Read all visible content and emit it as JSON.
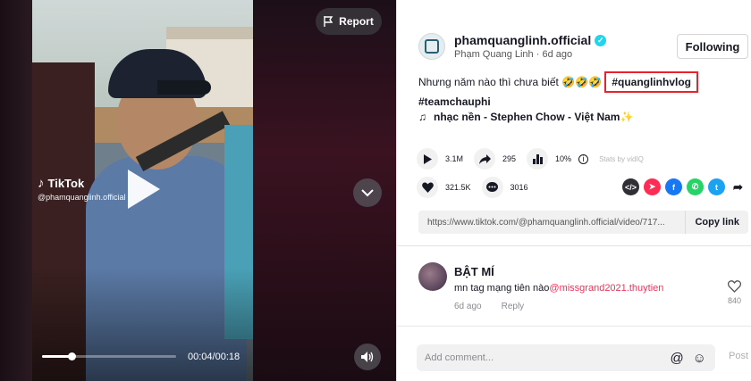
{
  "video": {
    "watermark_brand": "TikTok",
    "watermark_handle": "@phamquanglinh.official",
    "report_label": "Report",
    "time_display": "00:04/00:18",
    "progress_fraction": 0.22
  },
  "author": {
    "username": "phamquanglinh.official",
    "display_name": "Phạm Quang Linh",
    "posted": "6d ago",
    "follow_label": "Following"
  },
  "caption": {
    "text": "Nhưng năm nào thì chưa biết 🤣🤣🤣",
    "hashtag_highlighted": "#quanglinhvlog",
    "hashtag_2": "#teamchauphi"
  },
  "music": {
    "label": "nhạc nền - Stephen Chow - Việt Nam✨"
  },
  "stats": {
    "plays": "3.1M",
    "shares": "295",
    "engagement": "10%",
    "stats_by": "Stats by vidIQ",
    "likes": "321.5K",
    "comments": "3016"
  },
  "share": {
    "url": "https://www.tiktok.com/@phamquanglinh.official/video/717...",
    "copy_label": "Copy link"
  },
  "comment": {
    "author": "BẬT MÍ",
    "text": "mn tag mạng tiên nào",
    "mention": "@missgrand2021.thuytien",
    "time": "6d ago",
    "reply_label": "Reply",
    "likes": "840"
  },
  "composer": {
    "placeholder": "Add comment...",
    "post_label": "Post"
  },
  "colors": {
    "accent": "#fe2c55",
    "highlight_box": "#e8232e",
    "verified": "#20d5ec"
  }
}
